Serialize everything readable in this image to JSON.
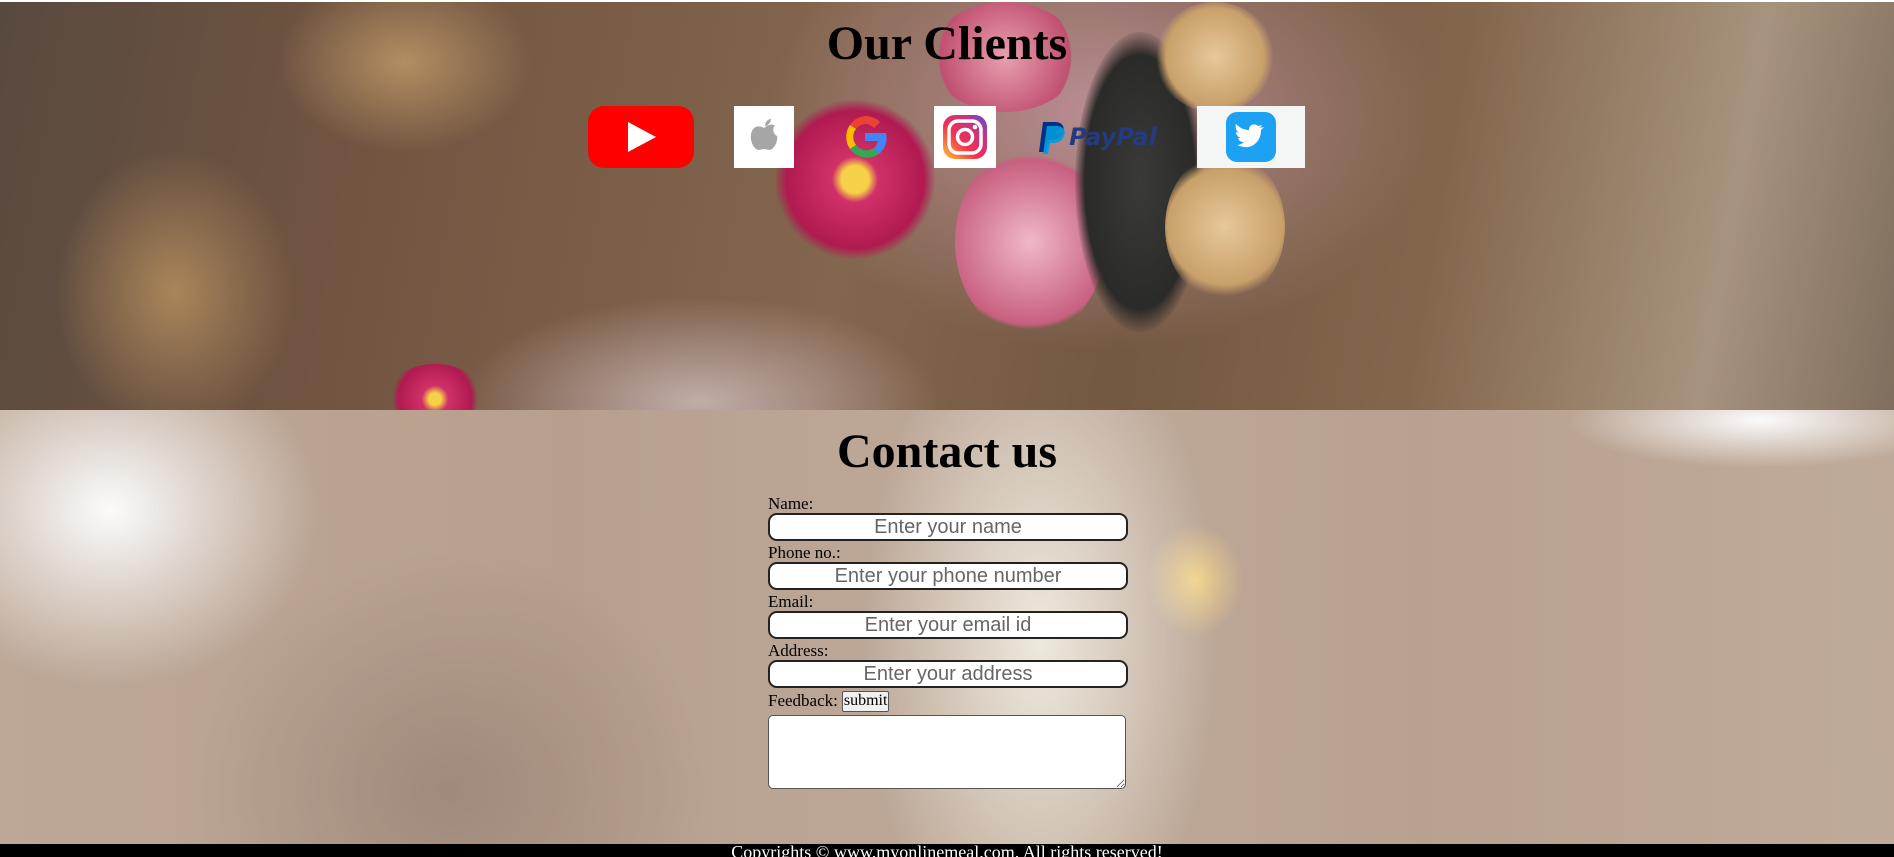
{
  "clients": {
    "title": "Our Clients",
    "logos": [
      {
        "name": "YouTube",
        "icon": "youtube-icon",
        "color": "#ff0000"
      },
      {
        "name": "Apple",
        "icon": "apple-icon",
        "color": "#a6a6a6"
      },
      {
        "name": "Google",
        "icon": "google-icon",
        "color": "#4285f4"
      },
      {
        "name": "Instagram",
        "icon": "instagram-icon",
        "color": "#e1306c"
      },
      {
        "name": "PayPal",
        "icon": "paypal-icon",
        "label": "PayPal",
        "color": "#003087"
      },
      {
        "name": "Twitter",
        "icon": "twitter-icon",
        "color": "#1da1f2"
      }
    ]
  },
  "contact": {
    "title": "Contact us",
    "fields": [
      {
        "label": "Name:",
        "placeholder": "Enter your name"
      },
      {
        "label": "Phone no.:",
        "placeholder": "Enter your phone number"
      },
      {
        "label": "Email:",
        "placeholder": "Enter your email id"
      },
      {
        "label": "Address:",
        "placeholder": "Enter your address"
      }
    ],
    "feedback_label": "Feedback:",
    "submit_label": "submit"
  },
  "footer": {
    "text": "Copyrights © www.myonlinemeal.com. All rights reserved!"
  }
}
